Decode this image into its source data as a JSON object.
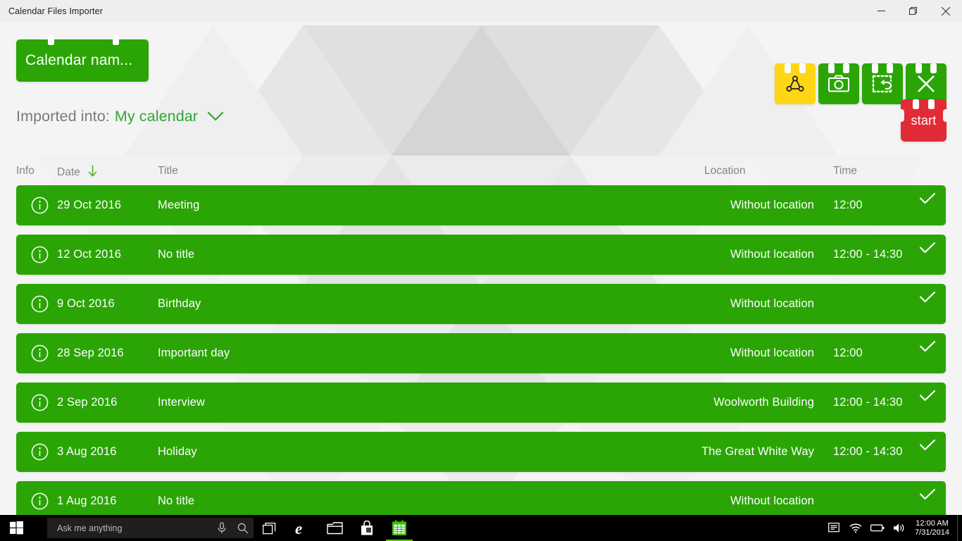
{
  "window": {
    "title": "Calendar Files Importer",
    "controls": {
      "minimize": "minimize-icon",
      "maximize": "restore-icon",
      "close": "close-icon"
    }
  },
  "header": {
    "calendar_name_label": "Calendar nam...",
    "accent_color": "#fdd615",
    "brand_green": "#2aa505",
    "start_red": "#e12b36",
    "toolbar": [
      {
        "name": "share-icon",
        "label": "Share",
        "accent": true
      },
      {
        "name": "camera-icon",
        "label": "Screenshot",
        "accent": false
      },
      {
        "name": "reset-selection-icon",
        "label": "Reset",
        "accent": false
      },
      {
        "name": "close-icon",
        "label": "Close",
        "accent": false
      }
    ]
  },
  "import_bar": {
    "label": "Imported into:",
    "value": "My calendar",
    "chevron": "chevron-down-icon",
    "start_label": "start"
  },
  "table": {
    "columns": {
      "info": "Info",
      "date": "Date",
      "title": "Title",
      "location": "Location",
      "time": "Time"
    },
    "sort": {
      "column": "Date",
      "direction": "descending",
      "icon": "arrow-down-icon"
    },
    "rows": [
      {
        "info": "info-icon",
        "date": "29 Oct 2016",
        "title": "Meeting",
        "location": "Without location",
        "time": "12:00",
        "checked": true
      },
      {
        "info": "info-icon",
        "date": "12 Oct 2016",
        "title": "No title",
        "location": "Without location",
        "time": "12:00 - 14:30",
        "checked": true
      },
      {
        "info": "info-icon",
        "date": "9 Oct 2016",
        "title": "Birthday",
        "location": "Without location",
        "time": "",
        "checked": true
      },
      {
        "info": "info-icon",
        "date": "28 Sep 2016",
        "title": "Important day",
        "location": "Without location",
        "time": "12:00",
        "checked": true
      },
      {
        "info": "info-icon",
        "date": "2  Sep 2016",
        "title": "Interview",
        "location": "Woolworth Building",
        "time": "12:00 - 14:30",
        "checked": true
      },
      {
        "info": "info-icon",
        "date": "3 Aug 2016",
        "title": "Holiday",
        "location": "The Great White Way",
        "time": "12:00 - 14:30",
        "checked": true
      },
      {
        "info": "info-icon",
        "date": "1 Aug 2016",
        "title": "No title",
        "location": "Without location",
        "time": "",
        "checked": true
      }
    ]
  },
  "taskbar": {
    "start": "windows-logo-icon",
    "search_placeholder": "Ask me anything",
    "search_value": "",
    "mic": "microphone-icon",
    "search_icon": "search-icon",
    "items": [
      {
        "name": "task-view-icon"
      },
      {
        "name": "edge-browser-icon"
      },
      {
        "name": "file-explorer-icon"
      },
      {
        "name": "microsoft-store-icon"
      },
      {
        "name": "calendar-importer-icon",
        "active": true
      }
    ],
    "tray": [
      {
        "name": "action-center-icon"
      },
      {
        "name": "wifi-icon"
      },
      {
        "name": "battery-icon"
      },
      {
        "name": "volume-icon"
      }
    ],
    "clock_time": "12:00 AM",
    "clock_date": "7/31/2014"
  }
}
